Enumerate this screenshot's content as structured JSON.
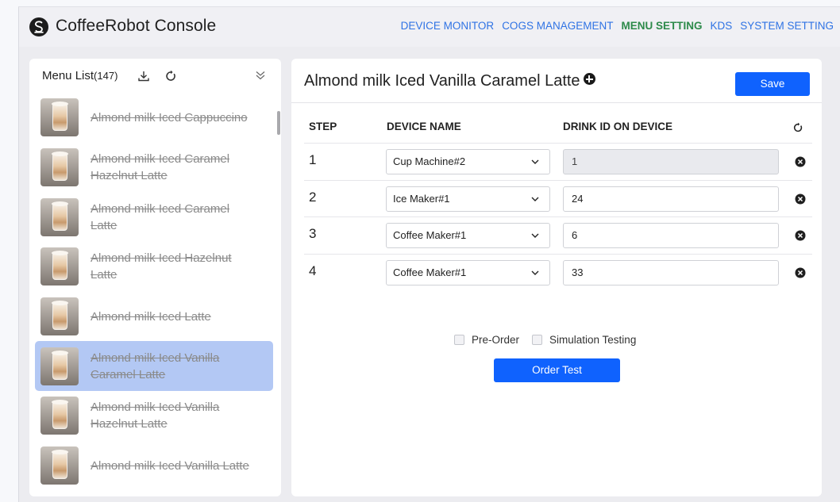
{
  "header": {
    "app_title": "CoffeeRobot Console",
    "nav": [
      {
        "label": "DEVICE MONITOR",
        "active": false
      },
      {
        "label": "COGS MANAGEMENT",
        "active": false
      },
      {
        "label": "MENU SETTING",
        "active": true
      },
      {
        "label": "KDS",
        "active": false
      },
      {
        "label": "SYSTEM SETTING",
        "active": false
      }
    ]
  },
  "menu_list": {
    "title": "Menu List",
    "count": "(147)",
    "items": [
      {
        "label": "Almond milk Iced Cappuccino",
        "selected": false
      },
      {
        "label": "Almond milk Iced Caramel Hazelnut Latte",
        "selected": false
      },
      {
        "label": "Almond milk Iced Caramel Latte",
        "selected": false
      },
      {
        "label": "Almond milk Iced Hazelnut Latte",
        "selected": false
      },
      {
        "label": "Almond milk Iced Latte",
        "selected": false
      },
      {
        "label": "Almond milk Iced Vanilla Caramel Latte",
        "selected": true
      },
      {
        "label": "Almond milk Iced Vanilla Hazelnut Latte",
        "selected": false
      },
      {
        "label": "Almond milk Iced Vanilla Latte",
        "selected": false
      }
    ]
  },
  "detail": {
    "title": "Almond milk Iced Vanilla Caramel Latte",
    "save_label": "Save",
    "columns": {
      "step": "STEP",
      "device": "DEVICE NAME",
      "drink_id": "DRINK ID ON DEVICE"
    },
    "rows": [
      {
        "step": "1",
        "device": "Cup Machine#2",
        "drink_id": "1",
        "disabled": true
      },
      {
        "step": "2",
        "device": "Ice Maker#1",
        "drink_id": "24",
        "disabled": false
      },
      {
        "step": "3",
        "device": "Coffee Maker#1",
        "drink_id": "6",
        "disabled": false
      },
      {
        "step": "4",
        "device": "Coffee Maker#1",
        "drink_id": "33",
        "disabled": false
      }
    ],
    "pre_order_label": "Pre-Order",
    "simulation_label": "Simulation Testing",
    "order_test_label": "Order Test"
  },
  "colors": {
    "accent": "#0f62fe",
    "nav_link": "#2f73e4",
    "nav_active": "#2d8a4a",
    "selected_row": "#b3c8f4"
  }
}
